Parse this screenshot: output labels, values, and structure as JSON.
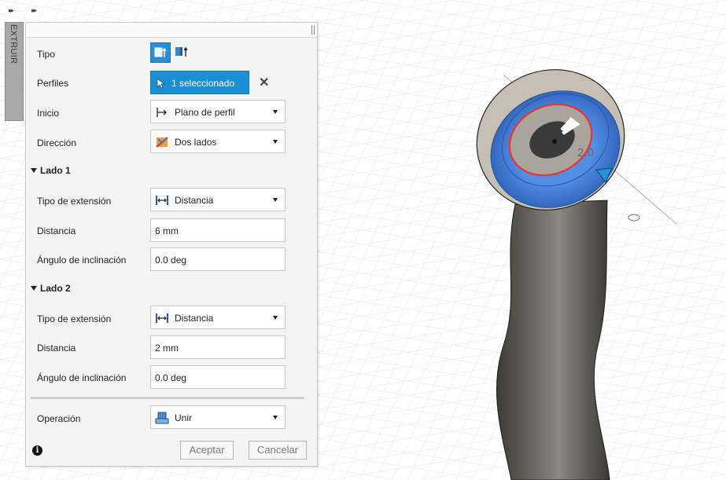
{
  "panel": {
    "side_tab_label": "EXTRUIR",
    "collapse_glyph": "▸▸"
  },
  "dialog": {
    "tipo": {
      "label": "Tipo",
      "icons": [
        "solid-extrude-icon",
        "thin-extrude-icon"
      ]
    },
    "perfiles": {
      "label": "Perfiles",
      "button_label": "1 seleccionado",
      "icon": "cursor-select-icon",
      "clear_glyph": "✕"
    },
    "inicio": {
      "label": "Inicio",
      "value": "Plano de perfil",
      "icon": "start-profile-plane-icon"
    },
    "direccion": {
      "label": "Dirección",
      "value": "Dos lados",
      "icon": "two-sides-icon"
    },
    "lado1": {
      "header": "Lado 1",
      "tipo_extension": {
        "label": "Tipo de extensión",
        "value": "Distancia",
        "icon": "distance-icon"
      },
      "distancia": {
        "label": "Distancia",
        "value": "6 mm"
      },
      "angulo": {
        "label": "Ángulo de inclinación",
        "value": "0.0 deg"
      }
    },
    "lado2": {
      "header": "Lado 2",
      "tipo_extension": {
        "label": "Tipo de extensión",
        "value": "Distancia",
        "icon": "distance-icon"
      },
      "distancia": {
        "label": "Distancia",
        "value": "2 mm"
      },
      "angulo": {
        "label": "Ángulo de inclinación",
        "value": "0.0 deg"
      }
    },
    "operacion": {
      "label": "Operación",
      "value": "Unir",
      "icon": "join-icon"
    },
    "footer": {
      "info_glyph": "i",
      "accept_label": "Aceptar",
      "cancel_label": "Cancelar"
    }
  },
  "viewport": {
    "dimension_label": "2.0",
    "model": "curved-tube-with-extrude-preview",
    "colors": {
      "accent": "#1a8fd6",
      "preview_blue": "#3f7fd8",
      "tube": "#5b5954",
      "profile_red": "#e03a3a"
    }
  }
}
